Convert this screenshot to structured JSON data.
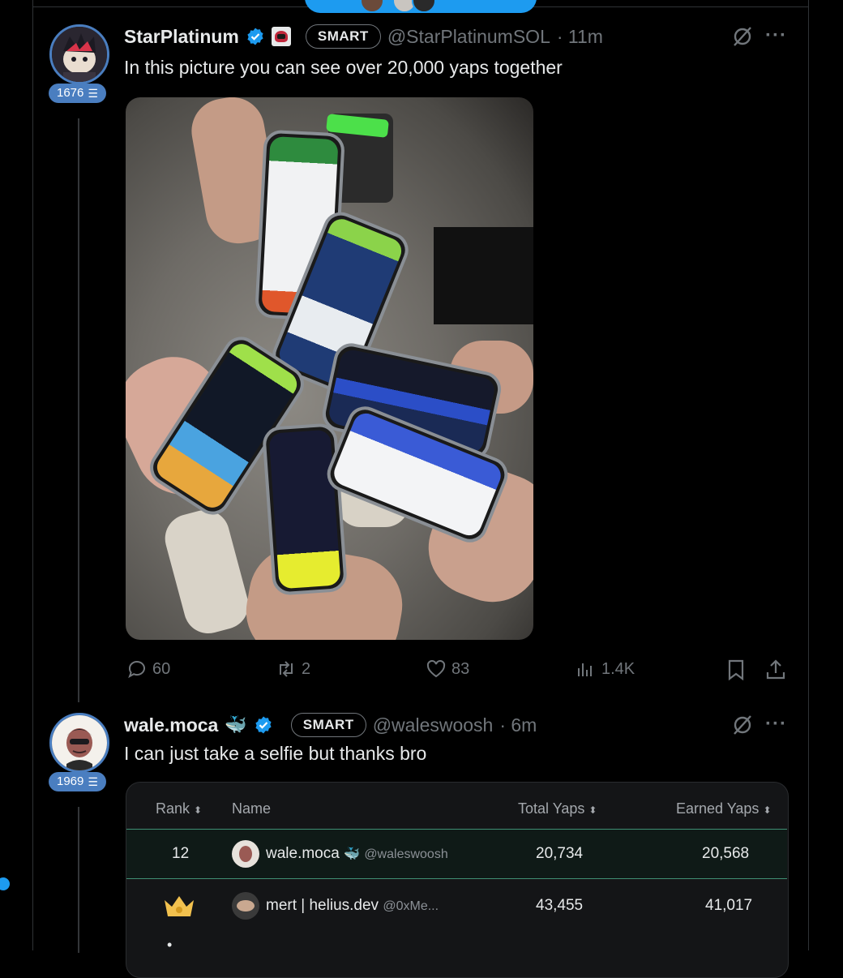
{
  "colors": {
    "accent": "#1d9bf0",
    "badge": "#4a7ec0",
    "muted": "#71767b",
    "highlight_border": "#3f8f73"
  },
  "tweet1": {
    "name": "StarPlatinum",
    "smart_label": "SMART",
    "handle": "@StarPlatinumSOL",
    "time": "· 11m",
    "badge_count": "1676",
    "text": "In this picture you can see over 20,000 yaps together",
    "stats": {
      "replies": "60",
      "retweets": "2",
      "likes": "83",
      "views": "1.4K"
    }
  },
  "tweet2": {
    "name": "wale.moca",
    "smart_label": "SMART",
    "handle": "@waleswoosh",
    "time": "· 6m",
    "badge_count": "1969",
    "text": "I can just take a selfie but thanks bro"
  },
  "leaderboard": {
    "columns": [
      "Rank",
      "Name",
      "Total Yaps",
      "Earned Yaps"
    ],
    "rows": [
      {
        "rank": "12",
        "name": "wale.moca",
        "handle": "@waleswoosh",
        "total": "20,734",
        "earned": "20,568",
        "highlighted": true
      },
      {
        "rank_icon": "crown-icon",
        "name": "mert | helius.dev",
        "handle": "@0xMe...",
        "total": "43,455",
        "earned": "41,017",
        "highlighted": false
      }
    ]
  }
}
